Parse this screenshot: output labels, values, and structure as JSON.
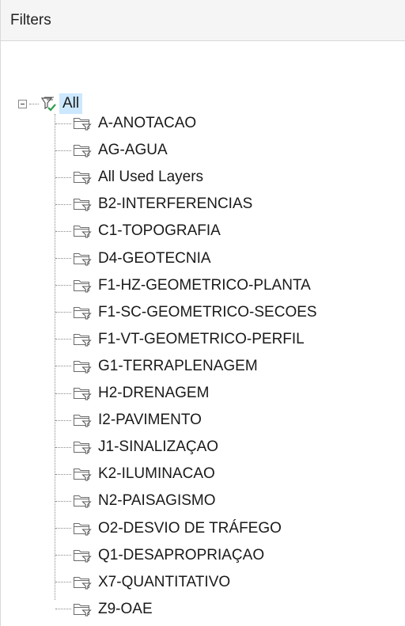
{
  "panel": {
    "title": "Filters"
  },
  "tree": {
    "root": {
      "label": "All",
      "icon": "filter-check-icon",
      "expanded": true,
      "selected": true
    },
    "children": [
      {
        "label": "A-ANOTACAO",
        "icon": "folder-filter-icon"
      },
      {
        "label": "AG-AGUA",
        "icon": "folder-filter-icon"
      },
      {
        "label": "All Used Layers",
        "icon": "folder-filter-icon"
      },
      {
        "label": "B2-INTERFERENCIAS",
        "icon": "folder-filter-icon"
      },
      {
        "label": "C1-TOPOGRAFIA",
        "icon": "folder-filter-icon"
      },
      {
        "label": "D4-GEOTECNIA",
        "icon": "folder-filter-icon"
      },
      {
        "label": "F1-HZ-GEOMETRICO-PLANTA",
        "icon": "folder-filter-icon"
      },
      {
        "label": "F1-SC-GEOMETRICO-SECOES",
        "icon": "folder-filter-icon"
      },
      {
        "label": "F1-VT-GEOMETRICO-PERFIL",
        "icon": "folder-filter-icon"
      },
      {
        "label": "G1-TERRAPLENAGEM",
        "icon": "folder-filter-icon"
      },
      {
        "label": "H2-DRENAGEM",
        "icon": "folder-filter-icon"
      },
      {
        "label": "I2-PAVIMENTO",
        "icon": "folder-filter-icon"
      },
      {
        "label": "J1-SINALIZAÇAO",
        "icon": "folder-filter-icon"
      },
      {
        "label": "K2-ILUMINACAO",
        "icon": "folder-filter-icon"
      },
      {
        "label": "N2-PAISAGISMO",
        "icon": "folder-filter-icon"
      },
      {
        "label": "O2-DESVIO DE TRÁFEGO",
        "icon": "folder-filter-icon"
      },
      {
        "label": "Q1-DESAPROPRIAÇAO",
        "icon": "folder-filter-icon"
      },
      {
        "label": "X7-QUANTITATIVO",
        "icon": "folder-filter-icon"
      },
      {
        "label": "Z9-OAE",
        "icon": "folder-filter-icon"
      }
    ]
  },
  "colors": {
    "selection": "#cce8ff",
    "check": "#2e9e4f",
    "header_bg": "#f5f5f5"
  }
}
